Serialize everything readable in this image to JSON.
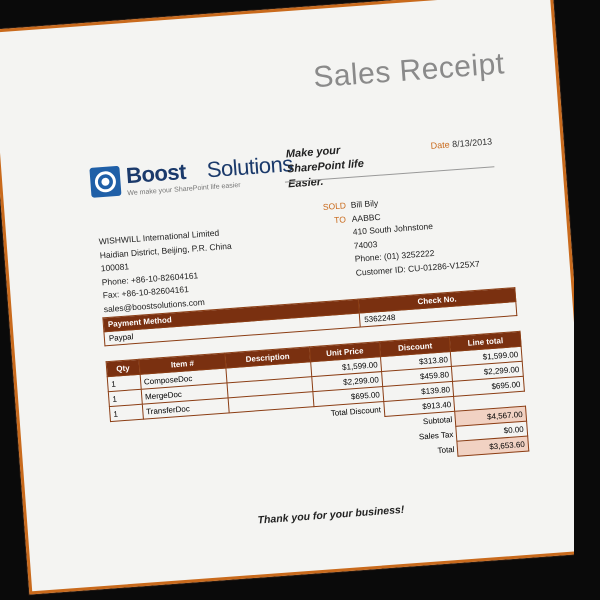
{
  "receipt": {
    "title": "Sales Receipt",
    "logo": {
      "name_part1": "Boost",
      "name_part2": "Solutions",
      "tagline": "We make your SharePoint life easier"
    },
    "slogan": "Make your SharePoint life Easier.",
    "date_label": "Date",
    "date_value": "8/13/2013",
    "from": {
      "company": "WISHWILL International Limited",
      "address": "Haidian District, Beijing, P.R. China",
      "postal": "100081",
      "phone": "Phone: +86-10-82604161",
      "fax": "Fax: +86-10-82604161",
      "email": "sales@boostsolutions.com"
    },
    "sold_to": {
      "label_sold": "SOLD",
      "label_to": "TO",
      "name": "Bill Bily",
      "company": "AABBC",
      "street": "410 South Johnstone",
      "zip": "74003",
      "phone": "Phone: (01) 3252222",
      "customer_id": "Customer ID: CU-01286-V125X7"
    },
    "payment": {
      "method_header": "Payment Method",
      "check_header": "Check No.",
      "method_value": "Paypal",
      "check_value": "5362248"
    },
    "items": {
      "headers": {
        "qty": "Qty",
        "item": "Item #",
        "description": "Description",
        "unit_price": "Unit Price",
        "discount": "Discount",
        "line_total": "Line total"
      },
      "rows": [
        {
          "qty": "1",
          "item": "ComposeDoc",
          "description": "",
          "unit_price": "$1,599.00",
          "discount": "$313.80",
          "line_total": "$1,599.00"
        },
        {
          "qty": "1",
          "item": "MergeDoc",
          "description": "",
          "unit_price": "$2,299.00",
          "discount": "$459.80",
          "line_total": "$2,299.00"
        },
        {
          "qty": "1",
          "item": "TransferDoc",
          "description": "",
          "unit_price": "$695.00",
          "discount": "$139.80",
          "line_total": "$695.00"
        }
      ],
      "total_discount_label": "Total Discount",
      "total_discount_value": "$913.40"
    },
    "totals": {
      "subtotal_label": "Subtotal",
      "subtotal_value": "$4,567.00",
      "tax_label": "Sales Tax",
      "tax_value": "$0.00",
      "total_label": "Total",
      "total_value": "$3,653.60"
    },
    "thanks": "Thank you for your business!"
  },
  "colors": {
    "accent": "#c96a1c",
    "table_header": "#7a3010",
    "logo_blue": "#1f5fa7",
    "total_shade": "#f1d2c3"
  }
}
